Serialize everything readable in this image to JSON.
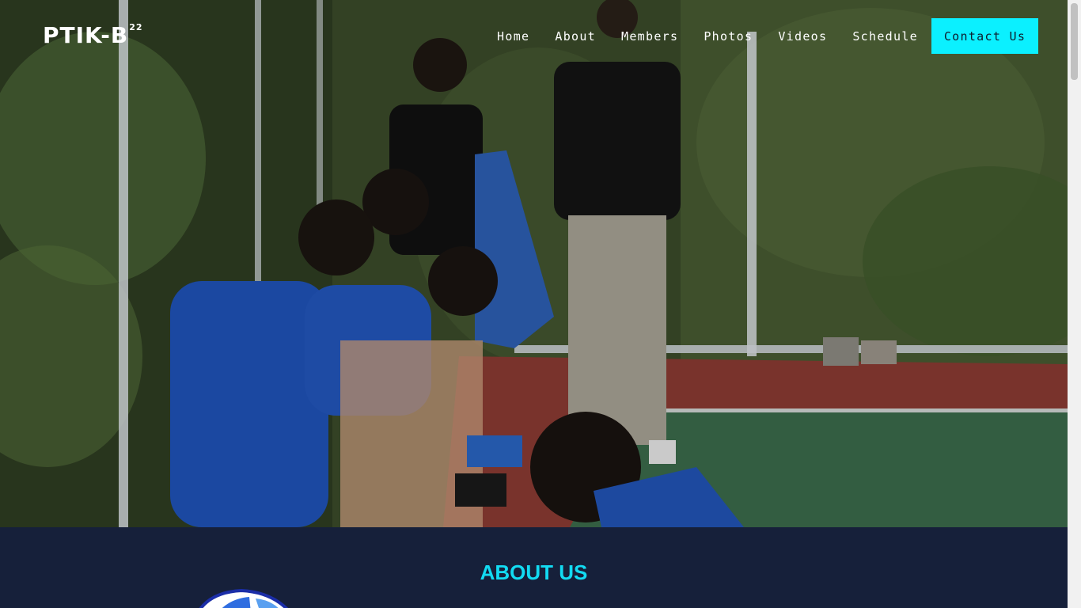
{
  "brand": {
    "name": "PTIK-B",
    "superscript": "22"
  },
  "nav": {
    "links": [
      "Home",
      "About",
      "Members",
      "Photos",
      "Videos",
      "Schedule"
    ],
    "cta": "Contact Us"
  },
  "about": {
    "title": "ABOUT US"
  },
  "colors": {
    "accent": "#0bf0ff",
    "about_bg": "#16203a",
    "about_title": "#12dbf2"
  }
}
